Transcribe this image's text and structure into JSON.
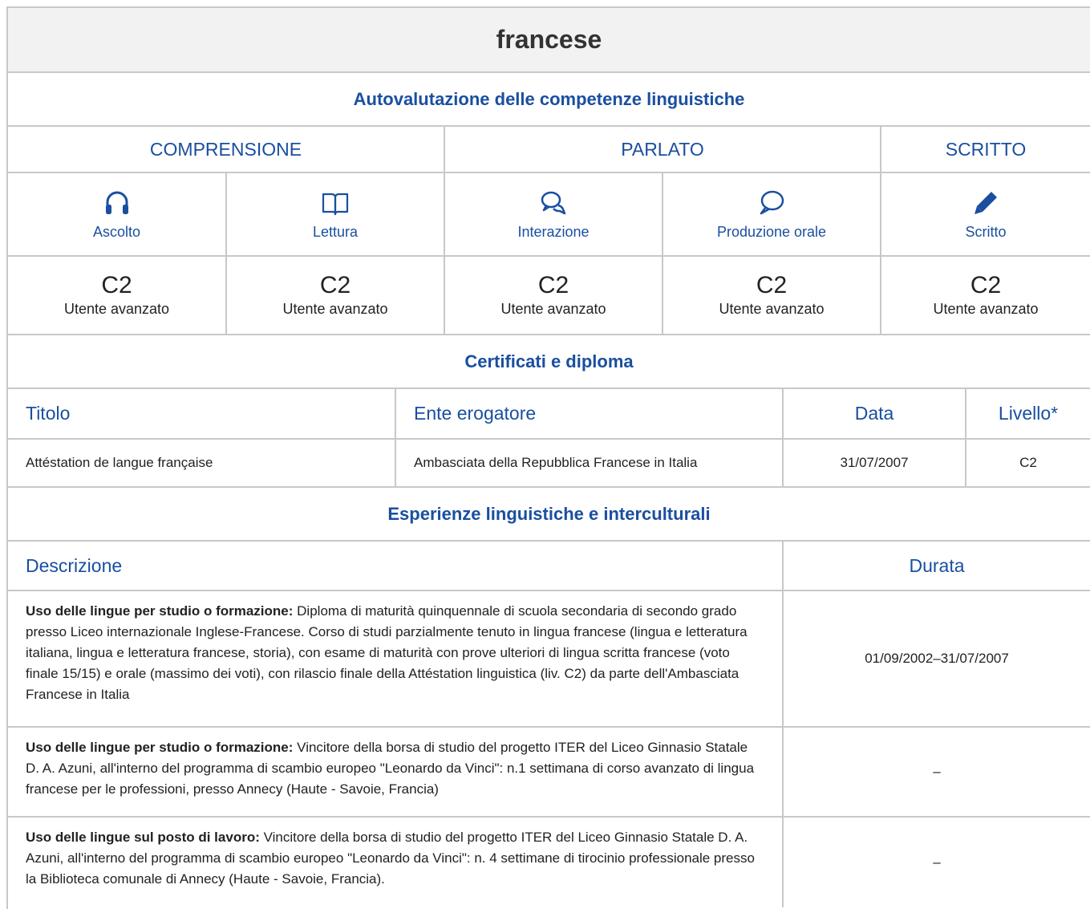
{
  "language": {
    "name": "francese"
  },
  "self_assessment": {
    "title": "Autovalutazione delle competenze linguistiche",
    "groups": [
      {
        "label": "COMPRENSIONE"
      },
      {
        "label": "PARLATO"
      },
      {
        "label": "SCRITTO"
      }
    ],
    "skills": [
      {
        "label": "Ascolto",
        "icon": "headphones-icon",
        "level": "C2",
        "level_desc": "Utente avanzato"
      },
      {
        "label": "Lettura",
        "icon": "book-icon",
        "level": "C2",
        "level_desc": "Utente avanzato"
      },
      {
        "label": "Interazione",
        "icon": "chat-bubbles-icon",
        "level": "C2",
        "level_desc": "Utente avanzato"
      },
      {
        "label": "Produzione orale",
        "icon": "speech-bubble-icon",
        "level": "C2",
        "level_desc": "Utente avanzato"
      },
      {
        "label": "Scritto",
        "icon": "pencil-icon",
        "level": "C2",
        "level_desc": "Utente avanzato"
      }
    ]
  },
  "certificates": {
    "title": "Certificati e diploma",
    "headers": {
      "title": "Titolo",
      "issuer": "Ente erogatore",
      "date": "Data",
      "level": "Livello*"
    },
    "rows": [
      {
        "title": "Attéstation de langue française",
        "issuer": "Ambasciata della Repubblica Francese in Italia",
        "date": "31/07/2007",
        "level": "C2"
      }
    ]
  },
  "experiences": {
    "title": "Esperienze linguistiche e interculturali",
    "headers": {
      "description": "Descrizione",
      "duration": "Durata"
    },
    "rows": [
      {
        "type": "Uso delle lingue per studio o formazione:",
        "text": "Diploma di maturità quinquennale di scuola secondaria di secondo grado presso Liceo internazionale Inglese-Francese. Corso di studi parzialmente tenuto in lingua francese (lingua e letteratura italiana, lingua e letteratura francese, storia), con esame di maturità con prove ulteriori di lingua scritta francese (voto finale 15/15) e orale (massimo dei voti), con rilascio finale della Attéstation linguistica (liv. C2) da parte dell'Ambasciata Francese in Italia",
        "duration": "01/09/2002–31/07/2007"
      },
      {
        "type": "Uso delle lingue per studio o formazione:",
        "text": "Vincitore della borsa di studio del progetto ITER del Liceo Ginnasio Statale D. A. Azuni, all'interno del programma di scambio europeo \"Leonardo da Vinci\": n.1 settimana di corso avanzato di lingua francese per le professioni, presso Annecy (Haute - Savoie, Francia)",
        "duration": "–"
      },
      {
        "type": "Uso delle lingue sul posto di lavoro:",
        "text": "Vincitore della borsa di studio del progetto ITER del Liceo Ginnasio Statale D. A. Azuni, all'interno del programma di scambio europeo \"Leonardo da Vinci\":  n. 4 settimane di tirocinio professionale presso la Biblioteca comunale di Annecy (Haute - Savoie, Francia).",
        "duration": "–"
      }
    ]
  },
  "colors": {
    "accent": "#1a4fa0",
    "border": "#c8c8c8",
    "header_bg": "#f2f2f2"
  }
}
